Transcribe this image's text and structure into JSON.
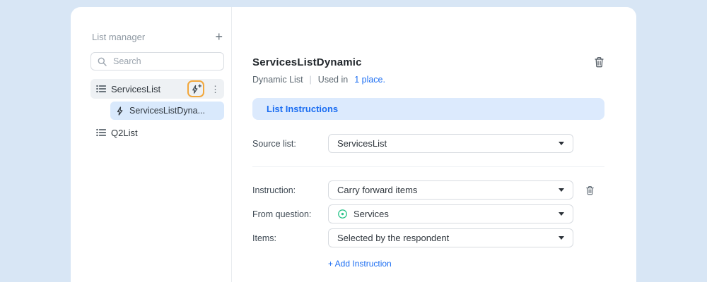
{
  "icons": {
    "kebab": "⋮"
  },
  "colors": {
    "highlight": "#F2A73B",
    "banner_bg": "#DCEAFD",
    "banner_text": "#1C6EF2",
    "link": "#1C6EF2",
    "green": "#2BC48A"
  },
  "sidebar": {
    "title": "List manager",
    "add_button": "+",
    "search": {
      "placeholder": "Search"
    },
    "items": [
      {
        "label": "ServicesList"
      },
      {
        "label": "ServicesListDyna..."
      },
      {
        "label": "Q2List"
      }
    ]
  },
  "main": {
    "title": "ServicesListDynamic",
    "subtitle": {
      "type": "Dynamic List",
      "separator": "|",
      "used_prefix": "Used in",
      "used_link": "1 place."
    },
    "banner": "List Instructions",
    "fields": [
      {
        "label": "Source list:",
        "value": "ServicesList"
      },
      {
        "label": "Instruction:",
        "value": "Carry forward items"
      },
      {
        "label": "From question:",
        "value": "Services"
      },
      {
        "label": "Items:",
        "value": "Selected by the respondent"
      }
    ],
    "add_instruction": "+ Add Instruction"
  }
}
